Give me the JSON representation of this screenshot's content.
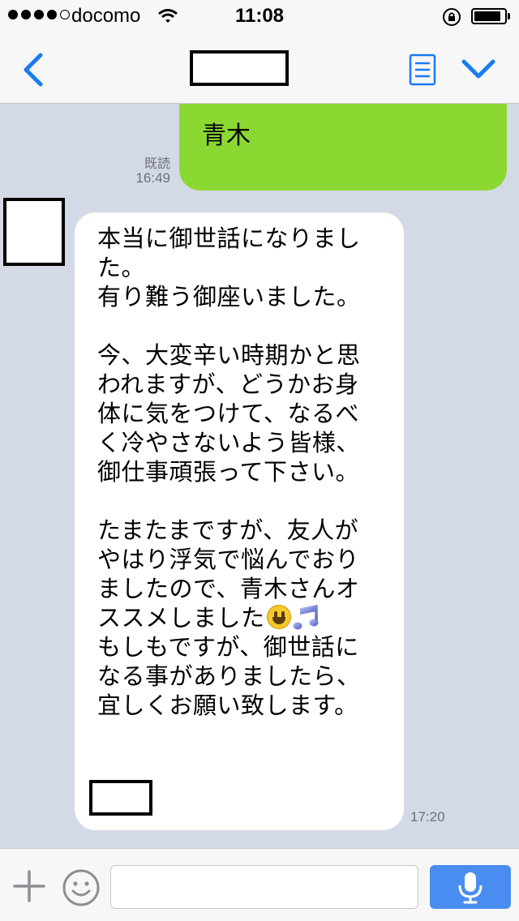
{
  "status_bar": {
    "carrier": "docomo",
    "time": "11:08",
    "signal_bars": 4,
    "signal_total": 5,
    "battery_level": 0.9
  },
  "nav": {
    "title": "",
    "back_icon": "chevron-left-icon",
    "menu_icon": "note-icon",
    "expand_icon": "chevron-down-icon",
    "accent_color": "#1a7cf0"
  },
  "chat": {
    "background_color": "#d4dae5",
    "sent": {
      "text": "青木",
      "read_label": "既読",
      "time": "16:49",
      "bubble_color": "#8cd833"
    },
    "received": {
      "lines": [
        "本当に御世話になりまし",
        "た。",
        "有り難う御座いました。",
        "",
        "今、大変辛い時期かと思",
        "われますが、どうかお身",
        "体に気をつけて、なるべ",
        "く冷やさないよう皆様、",
        "御仕事頑張って下さい。",
        "",
        "たまたまですが、友人が",
        "やはり浮気で悩んでおり",
        "ましたので、青木さんオ",
        "ススメしました",
        "もしもですが、御世話に",
        "なる事がありましたら、",
        "宜しくお願い致します。"
      ],
      "emojis": [
        "smiley-face-icon",
        "music-notes-icon"
      ],
      "time": "17:20"
    }
  },
  "input_bar": {
    "plus_icon": "plus-icon",
    "sticker_icon": "smiley-icon",
    "placeholder": "",
    "mic_icon": "microphone-icon",
    "mic_color": "#4a8df0"
  }
}
